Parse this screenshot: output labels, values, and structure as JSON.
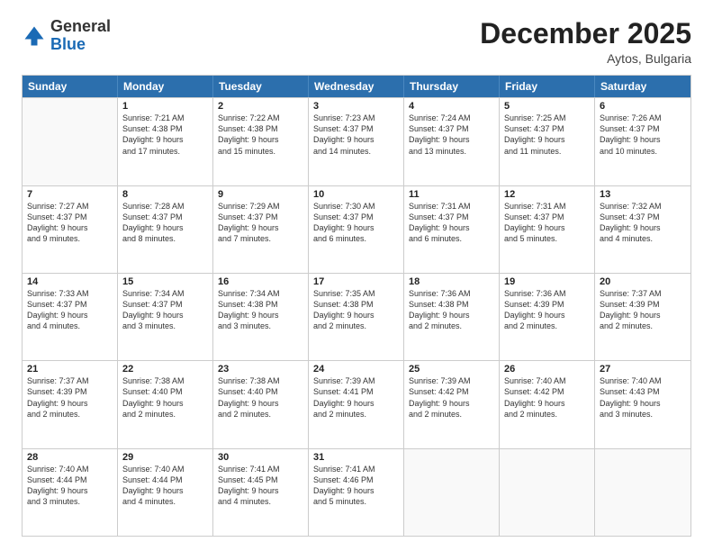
{
  "header": {
    "logo_line1": "General",
    "logo_line2": "Blue",
    "month": "December 2025",
    "location": "Aytos, Bulgaria"
  },
  "weekdays": [
    "Sunday",
    "Monday",
    "Tuesday",
    "Wednesday",
    "Thursday",
    "Friday",
    "Saturday"
  ],
  "rows": [
    [
      {
        "day": "",
        "info": ""
      },
      {
        "day": "1",
        "info": "Sunrise: 7:21 AM\nSunset: 4:38 PM\nDaylight: 9 hours\nand 17 minutes."
      },
      {
        "day": "2",
        "info": "Sunrise: 7:22 AM\nSunset: 4:38 PM\nDaylight: 9 hours\nand 15 minutes."
      },
      {
        "day": "3",
        "info": "Sunrise: 7:23 AM\nSunset: 4:37 PM\nDaylight: 9 hours\nand 14 minutes."
      },
      {
        "day": "4",
        "info": "Sunrise: 7:24 AM\nSunset: 4:37 PM\nDaylight: 9 hours\nand 13 minutes."
      },
      {
        "day": "5",
        "info": "Sunrise: 7:25 AM\nSunset: 4:37 PM\nDaylight: 9 hours\nand 11 minutes."
      },
      {
        "day": "6",
        "info": "Sunrise: 7:26 AM\nSunset: 4:37 PM\nDaylight: 9 hours\nand 10 minutes."
      }
    ],
    [
      {
        "day": "7",
        "info": "Sunrise: 7:27 AM\nSunset: 4:37 PM\nDaylight: 9 hours\nand 9 minutes."
      },
      {
        "day": "8",
        "info": "Sunrise: 7:28 AM\nSunset: 4:37 PM\nDaylight: 9 hours\nand 8 minutes."
      },
      {
        "day": "9",
        "info": "Sunrise: 7:29 AM\nSunset: 4:37 PM\nDaylight: 9 hours\nand 7 minutes."
      },
      {
        "day": "10",
        "info": "Sunrise: 7:30 AM\nSunset: 4:37 PM\nDaylight: 9 hours\nand 6 minutes."
      },
      {
        "day": "11",
        "info": "Sunrise: 7:31 AM\nSunset: 4:37 PM\nDaylight: 9 hours\nand 6 minutes."
      },
      {
        "day": "12",
        "info": "Sunrise: 7:31 AM\nSunset: 4:37 PM\nDaylight: 9 hours\nand 5 minutes."
      },
      {
        "day": "13",
        "info": "Sunrise: 7:32 AM\nSunset: 4:37 PM\nDaylight: 9 hours\nand 4 minutes."
      }
    ],
    [
      {
        "day": "14",
        "info": "Sunrise: 7:33 AM\nSunset: 4:37 PM\nDaylight: 9 hours\nand 4 minutes."
      },
      {
        "day": "15",
        "info": "Sunrise: 7:34 AM\nSunset: 4:37 PM\nDaylight: 9 hours\nand 3 minutes."
      },
      {
        "day": "16",
        "info": "Sunrise: 7:34 AM\nSunset: 4:38 PM\nDaylight: 9 hours\nand 3 minutes."
      },
      {
        "day": "17",
        "info": "Sunrise: 7:35 AM\nSunset: 4:38 PM\nDaylight: 9 hours\nand 2 minutes."
      },
      {
        "day": "18",
        "info": "Sunrise: 7:36 AM\nSunset: 4:38 PM\nDaylight: 9 hours\nand 2 minutes."
      },
      {
        "day": "19",
        "info": "Sunrise: 7:36 AM\nSunset: 4:39 PM\nDaylight: 9 hours\nand 2 minutes."
      },
      {
        "day": "20",
        "info": "Sunrise: 7:37 AM\nSunset: 4:39 PM\nDaylight: 9 hours\nand 2 minutes."
      }
    ],
    [
      {
        "day": "21",
        "info": "Sunrise: 7:37 AM\nSunset: 4:39 PM\nDaylight: 9 hours\nand 2 minutes."
      },
      {
        "day": "22",
        "info": "Sunrise: 7:38 AM\nSunset: 4:40 PM\nDaylight: 9 hours\nand 2 minutes."
      },
      {
        "day": "23",
        "info": "Sunrise: 7:38 AM\nSunset: 4:40 PM\nDaylight: 9 hours\nand 2 minutes."
      },
      {
        "day": "24",
        "info": "Sunrise: 7:39 AM\nSunset: 4:41 PM\nDaylight: 9 hours\nand 2 minutes."
      },
      {
        "day": "25",
        "info": "Sunrise: 7:39 AM\nSunset: 4:42 PM\nDaylight: 9 hours\nand 2 minutes."
      },
      {
        "day": "26",
        "info": "Sunrise: 7:40 AM\nSunset: 4:42 PM\nDaylight: 9 hours\nand 2 minutes."
      },
      {
        "day": "27",
        "info": "Sunrise: 7:40 AM\nSunset: 4:43 PM\nDaylight: 9 hours\nand 3 minutes."
      }
    ],
    [
      {
        "day": "28",
        "info": "Sunrise: 7:40 AM\nSunset: 4:44 PM\nDaylight: 9 hours\nand 3 minutes."
      },
      {
        "day": "29",
        "info": "Sunrise: 7:40 AM\nSunset: 4:44 PM\nDaylight: 9 hours\nand 4 minutes."
      },
      {
        "day": "30",
        "info": "Sunrise: 7:41 AM\nSunset: 4:45 PM\nDaylight: 9 hours\nand 4 minutes."
      },
      {
        "day": "31",
        "info": "Sunrise: 7:41 AM\nSunset: 4:46 PM\nDaylight: 9 hours\nand 5 minutes."
      },
      {
        "day": "",
        "info": ""
      },
      {
        "day": "",
        "info": ""
      },
      {
        "day": "",
        "info": ""
      }
    ]
  ]
}
